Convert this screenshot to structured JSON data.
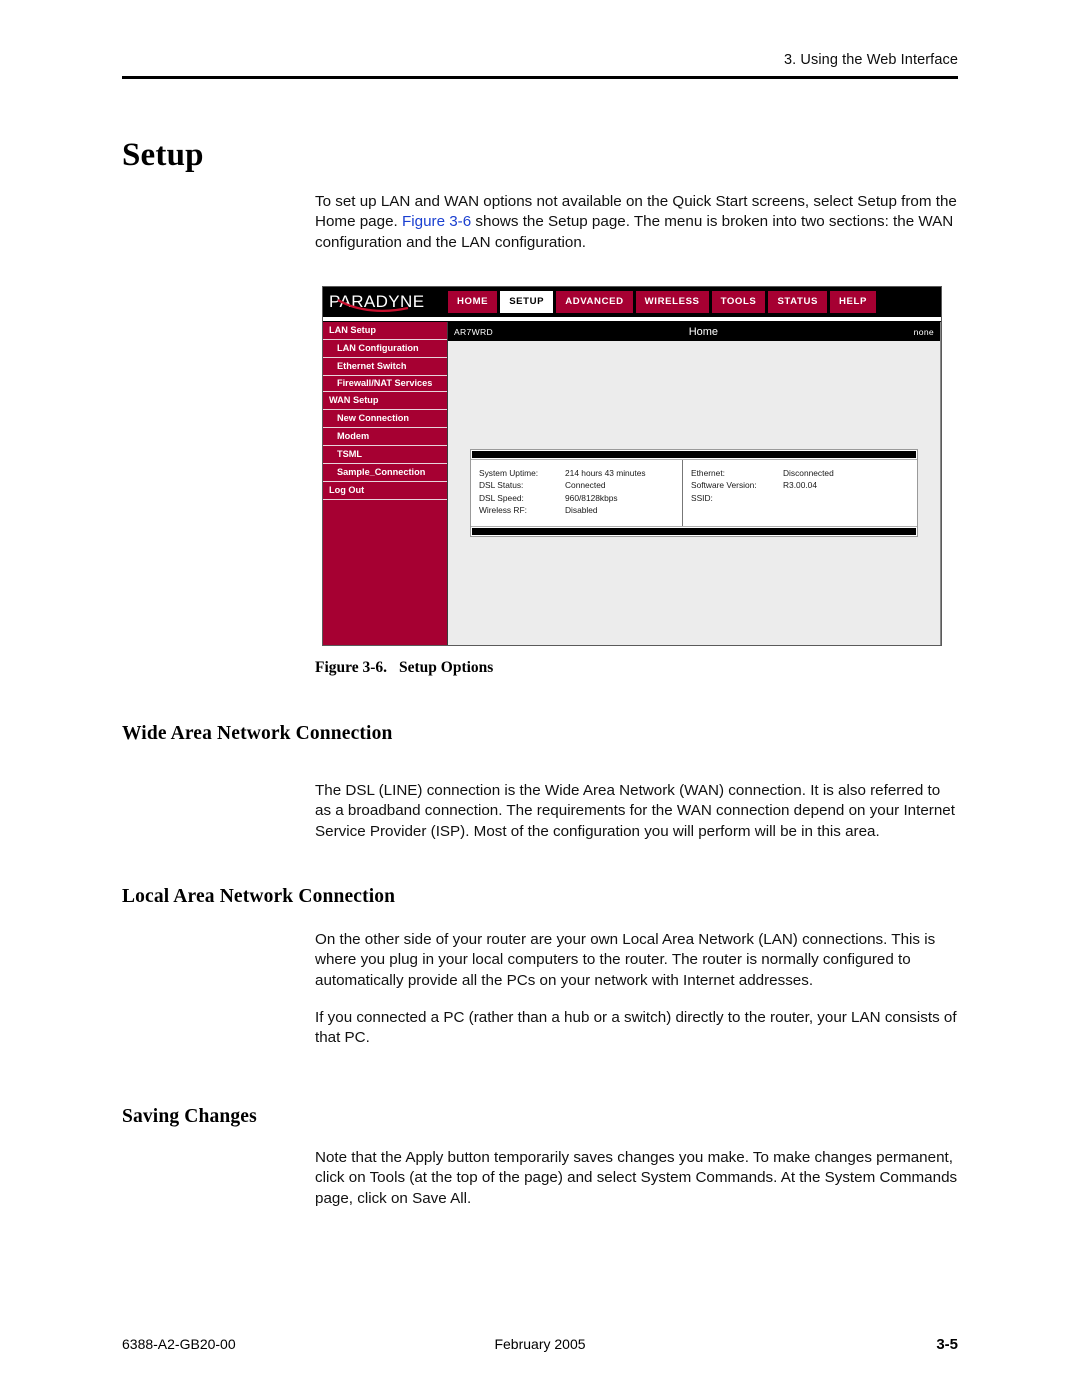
{
  "header": {
    "chapter": "3. Using the Web Interface"
  },
  "title": "Setup",
  "intro": {
    "part1": "To set up LAN and WAN options not available on the Quick Start screens, select Setup from the Home page. ",
    "figref": "Figure 3-6",
    "part2": " shows the Setup page. The menu is broken into two sections: the WAN configuration and the LAN configuration."
  },
  "figure": {
    "caption_number": "Figure 3-6.",
    "caption_text": "Setup Options",
    "colors": {
      "brand_crimson": "#a60032",
      "topbar_black": "#000000",
      "content_gray": "#ececec"
    },
    "logo": "PARADYNE",
    "tabs": [
      {
        "label": "HOME",
        "active": false
      },
      {
        "label": "SETUP",
        "active": true
      },
      {
        "label": "ADVANCED",
        "active": false
      },
      {
        "label": "WIRELESS",
        "active": false
      },
      {
        "label": "TOOLS",
        "active": false
      },
      {
        "label": "STATUS",
        "active": false
      },
      {
        "label": "HELP",
        "active": false
      }
    ],
    "sidebar": [
      {
        "label": "LAN Setup",
        "sub": false
      },
      {
        "label": "LAN Configuration",
        "sub": true
      },
      {
        "label": "Ethernet Switch",
        "sub": true
      },
      {
        "label": "Firewall/NAT Services",
        "sub": true
      },
      {
        "label": "WAN Setup",
        "sub": false
      },
      {
        "label": "New Connection",
        "sub": true
      },
      {
        "label": "Modem",
        "sub": true
      },
      {
        "label": "TSML",
        "sub": true
      },
      {
        "label": "Sample_Connection",
        "sub": true
      },
      {
        "label": "Log Out",
        "sub": false
      }
    ],
    "titlebar": {
      "device": "AR7WRD",
      "page": "Home",
      "right": "none"
    },
    "status_left": [
      {
        "key": "System Uptime:",
        "value": "214 hours 43 minutes"
      },
      {
        "key": "DSL Status:",
        "value": "Connected"
      },
      {
        "key": "DSL Speed:",
        "value": "960/8128kbps"
      },
      {
        "key": "Wireless RF:",
        "value": "Disabled"
      }
    ],
    "status_right": [
      {
        "key": "Ethernet:",
        "value": "Disconnected"
      },
      {
        "key": "Software Version:",
        "value": "R3.00.04"
      },
      {
        "key": "SSID:",
        "value": ""
      }
    ]
  },
  "sections": [
    {
      "heading": "Wide Area Network Connection",
      "paragraphs": [
        "The DSL (LINE) connection is the Wide Area Network (WAN) connection. It is also referred to as a broadband connection. The requirements for the WAN connection depend on your Internet Service Provider (ISP). Most of the configuration you will perform will be in this area."
      ]
    },
    {
      "heading": "Local Area Network Connection",
      "paragraphs": [
        "On the other side of your router are your own Local Area Network (LAN) connections. This is where you plug in your local computers to the router. The router is normally configured to automatically provide all the PCs on your network with Internet addresses.",
        "If you connected a PC (rather than a hub or a switch) directly to the router, your LAN consists of that PC."
      ]
    },
    {
      "heading": "Saving Changes",
      "paragraphs": [
        "Note that the Apply button temporarily saves changes you make. To make changes permanent, click on Tools (at the top of the page) and select System Commands. At the System Commands page, click on Save All."
      ]
    }
  ],
  "footer": {
    "doc_number": "6388-A2-GB20-00",
    "date": "February 2005",
    "page_number": "3-5"
  }
}
